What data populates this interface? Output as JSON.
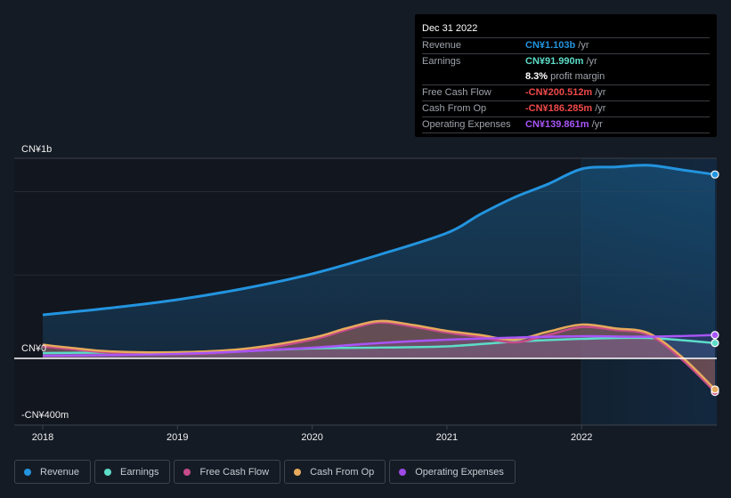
{
  "tooltip": {
    "date": "Dec 31 2022",
    "rows": [
      {
        "label": "Revenue",
        "value": "CN¥1.103b",
        "unit": "/yr",
        "color": "#2394df"
      },
      {
        "label": "Earnings",
        "value": "CN¥91.990m",
        "unit": "/yr",
        "color": "#5ddcc8"
      },
      {
        "label": "",
        "value": "8.3%",
        "unit": "profit margin",
        "color": "#ffffff"
      },
      {
        "label": "Free Cash Flow",
        "value": "-CN¥200.512m",
        "unit": "/yr",
        "color": "#f0494a"
      },
      {
        "label": "Cash From Op",
        "value": "-CN¥186.285m",
        "unit": "/yr",
        "color": "#f0494a"
      },
      {
        "label": "Operating Expenses",
        "value": "CN¥139.861m",
        "unit": "/yr",
        "color": "#a855f7"
      }
    ]
  },
  "legend": [
    {
      "label": "Revenue",
      "color": "#2394df"
    },
    {
      "label": "Earnings",
      "color": "#5ddcc8"
    },
    {
      "label": "Free Cash Flow",
      "color": "#c64b8a"
    },
    {
      "label": "Cash From Op",
      "color": "#e6aa5c"
    },
    {
      "label": "Operating Expenses",
      "color": "#9d4ae6"
    }
  ],
  "chart_data": {
    "type": "area",
    "title": "",
    "xlabel": "",
    "ylabel": "",
    "units": "CN¥ millions",
    "x_ticks": [
      "2018",
      "2019",
      "2020",
      "2021",
      "2022"
    ],
    "y_tick_labels": [
      "CN¥1b",
      "CN¥0",
      "-CN¥400m"
    ],
    "xlim": [
      2018.0,
      2022.99
    ],
    "ylim": [
      -400,
      1200
    ],
    "highlight_from": 2022.0,
    "grid": true,
    "legend_position": "bottom-left",
    "series": [
      {
        "name": "Revenue",
        "color": "#2394df",
        "x": [
          2018.0,
          2018.5,
          2019.0,
          2019.5,
          2020.0,
          2020.5,
          2021.0,
          2021.25,
          2021.5,
          2021.75,
          2022.0,
          2022.25,
          2022.5,
          2022.75,
          2022.99
        ],
        "y": [
          261,
          302,
          352,
          420,
          507,
          622,
          752,
          865,
          965,
          1045,
          1136,
          1148,
          1158,
          1130,
          1103
        ]
      },
      {
        "name": "Earnings",
        "color": "#5ddcc8",
        "x": [
          2018.0,
          2018.5,
          2019.0,
          2019.5,
          2020.0,
          2020.5,
          2021.0,
          2021.5,
          2022.0,
          2022.5,
          2022.99
        ],
        "y": [
          32,
          35,
          37,
          45,
          60,
          65,
          72,
          100,
          117,
          122,
          92
        ]
      },
      {
        "name": "Free Cash Flow",
        "color": "#c64b8a",
        "x": [
          2018.0,
          2018.25,
          2018.5,
          2019.0,
          2019.5,
          2020.0,
          2020.25,
          2020.5,
          2020.75,
          2021.0,
          2021.25,
          2021.5,
          2021.75,
          2022.0,
          2022.25,
          2022.5,
          2022.75,
          2022.99
        ],
        "y": [
          72,
          52,
          35,
          25,
          45,
          112,
          170,
          215,
          190,
          155,
          128,
          96,
          140,
          188,
          170,
          140,
          -10,
          -200.5
        ]
      },
      {
        "name": "Cash From Op",
        "color": "#e6aa5c",
        "x": [
          2018.0,
          2018.25,
          2018.5,
          2019.0,
          2019.5,
          2020.0,
          2020.25,
          2020.5,
          2020.75,
          2021.0,
          2021.25,
          2021.5,
          2021.75,
          2022.0,
          2022.25,
          2022.5,
          2022.75,
          2022.99
        ],
        "y": [
          82,
          60,
          42,
          37,
          58,
          123,
          180,
          224,
          200,
          165,
          140,
          112,
          160,
          203,
          180,
          150,
          5,
          -186.3
        ]
      },
      {
        "name": "Operating Expenses",
        "color": "#a855f7",
        "x": [
          2018.0,
          2018.5,
          2019.0,
          2019.5,
          2020.0,
          2020.5,
          2021.0,
          2021.5,
          2022.0,
          2022.5,
          2022.99
        ],
        "y": [
          16,
          20,
          27,
          42,
          64,
          92,
          112,
          125,
          133,
          130,
          139.9
        ]
      }
    ]
  }
}
